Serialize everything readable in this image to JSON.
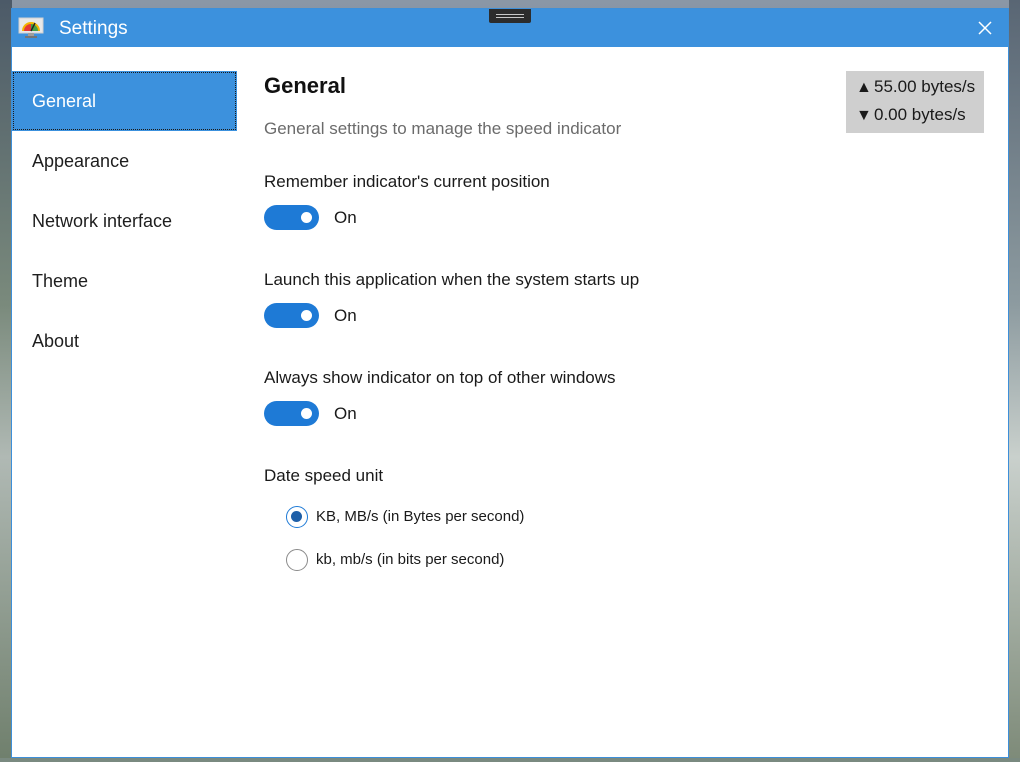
{
  "window": {
    "title": "Settings",
    "icon": "speed-meter-icon"
  },
  "sidebar": {
    "items": [
      {
        "label": "General",
        "active": true
      },
      {
        "label": "Appearance",
        "active": false
      },
      {
        "label": "Network interface",
        "active": false
      },
      {
        "label": "Theme",
        "active": false
      },
      {
        "label": "About",
        "active": false
      }
    ]
  },
  "main": {
    "title": "General",
    "subtitle": "General settings to manage the speed indicator",
    "settings": [
      {
        "label": "Remember indicator's current position",
        "state": "On",
        "enabled": true
      },
      {
        "label": "Launch this application when the system starts up",
        "state": "On",
        "enabled": true
      },
      {
        "label": "Always show indicator on top of other windows",
        "state": "On",
        "enabled": true
      }
    ],
    "speed_unit": {
      "label": "Date speed unit",
      "options": [
        {
          "label": "KB, MB/s (in Bytes per second)",
          "selected": true
        },
        {
          "label": "kb, mb/s (in bits per second)",
          "selected": false
        }
      ]
    }
  },
  "speed_indicator": {
    "upload_arrow": "▲",
    "download_arrow": "▼",
    "upload": "55.00 bytes/s",
    "download": "0.00 bytes/s"
  },
  "colors": {
    "accent": "#3c91dd",
    "toggle_on": "#1e7ad6",
    "indicator_bg": "#cfcfcf"
  }
}
